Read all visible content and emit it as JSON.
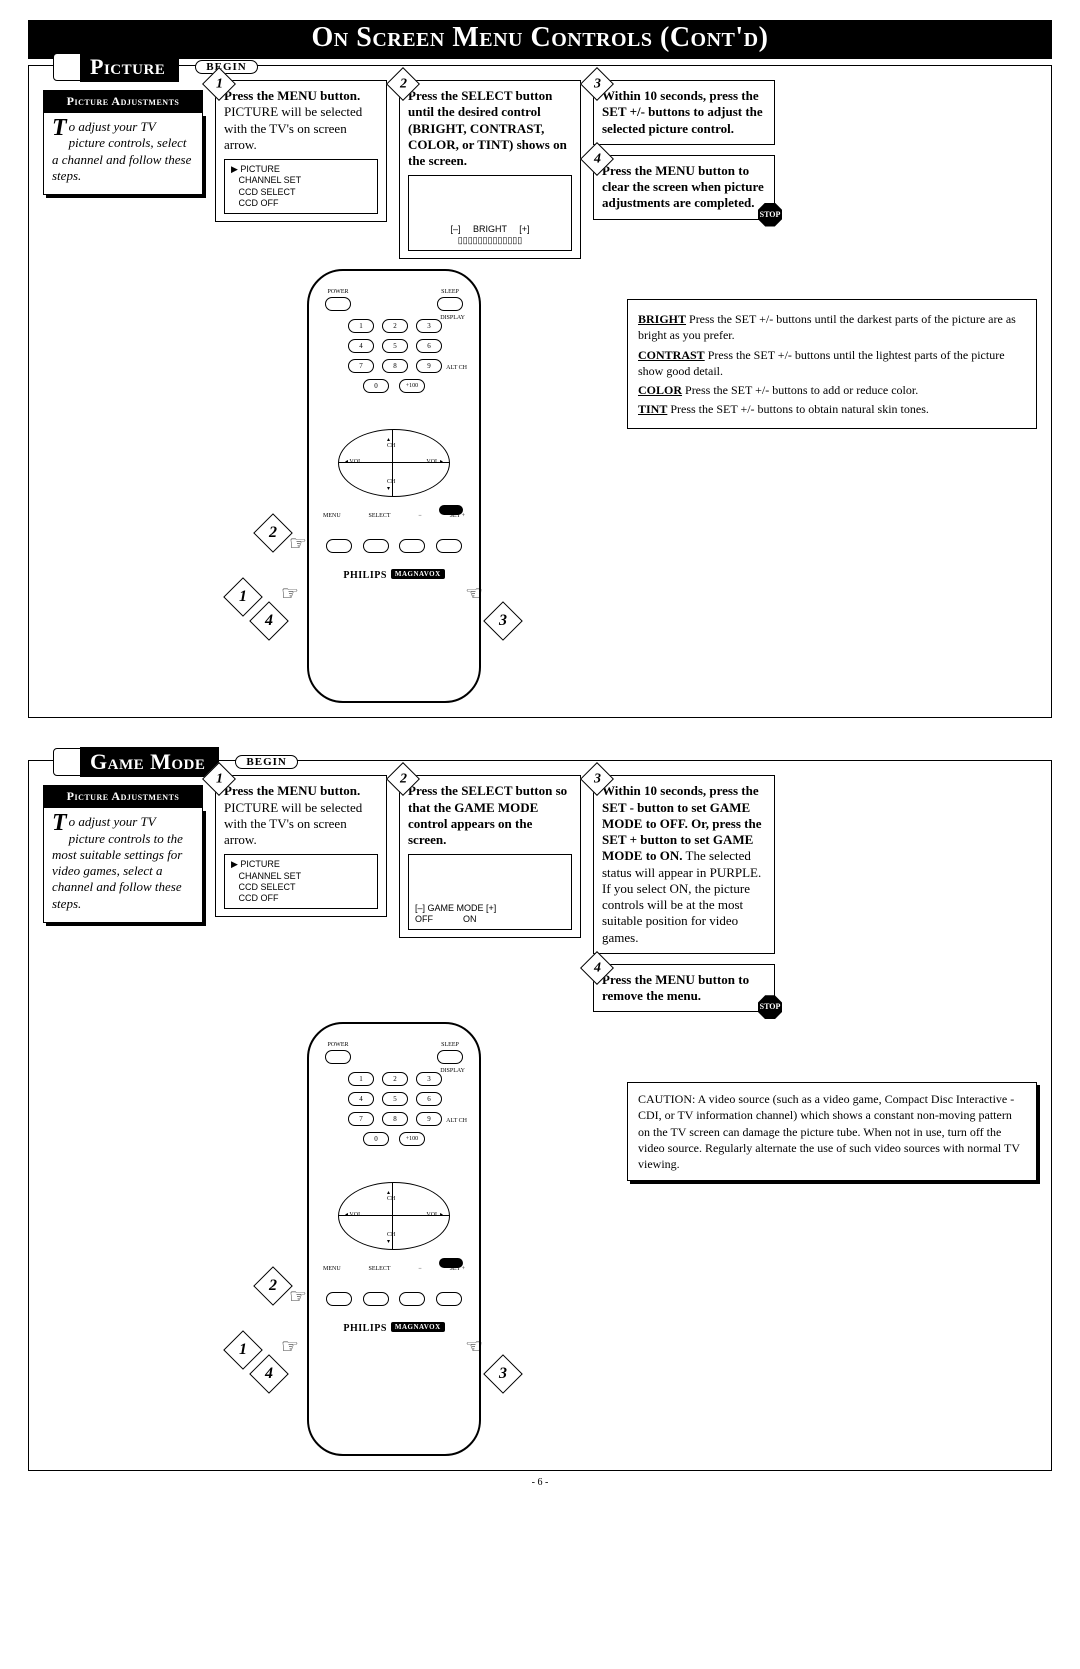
{
  "header": {
    "title": "On Screen Menu Controls (Cont'd)"
  },
  "begin_label": "BEGIN",
  "stop_label": "STOP",
  "remote": {
    "power": "POWER",
    "sleep": "SLEEP",
    "display": "DISPLAY",
    "alt_ch": "ALT CH",
    "menu": "MENU",
    "select": "SELECT",
    "minus": "−",
    "plus": "SET +",
    "ch_up": "CH",
    "ch_dn": "CH",
    "vol_l": "◂ VOL",
    "vol_r": "VOL ▸",
    "brand1": "PHILIPS",
    "brand2": "MAGNAVOX",
    "screen_menu": "▶ PICTURE\n   CHANNEL SET\n   CCD SELECT\n   CCD OFF"
  },
  "picture": {
    "title": "Picture",
    "adj_title": "Picture Adjustments",
    "adj_text": "o adjust your TV picture controls, select a channel and follow these steps.",
    "step1": "Press the MENU button. PICTURE will be selected with the TV's on screen arrow.",
    "step2": "Press the SELECT button until the desired control (BRIGHT, CONTRAST, COLOR, or TINT) shows on the screen.",
    "step2_screen": "[–]     BRIGHT     [+]\n▯▯▯▯▯▯▯▯▯▯▯▯▯",
    "step3": "Within 10 seconds, press the SET +/- buttons to adjust the selected picture control.",
    "step4": "Press the MENU button to clear the screen when picture adjustments are completed.",
    "defs": {
      "bright": "BRIGHT Press the SET +/- buttons until the darkest parts of the picture are as bright as you prefer.",
      "contrast": "CONTRAST Press the SET +/- buttons until the lightest parts of the picture show good detail.",
      "color": "COLOR Press the SET +/- buttons to add or reduce color.",
      "tint": "TINT Press the SET +/- buttons to obtain natural skin tones."
    }
  },
  "game": {
    "title": "Game Mode",
    "adj_title": "Picture Adjustments",
    "adj_text": "o adjust your TV picture controls to the most suitable settings for video games, select a channel and follow these steps.",
    "step1": "Press the MENU button. PICTURE will be selected with the TV's on screen arrow.",
    "step2": "Press the SELECT button so that the GAME MODE control appears on the screen.",
    "step2_screen": "[–] GAME MODE [+]\nOFF            ON",
    "step3a": "Within 10 seconds, press the SET - button to set GAME MODE to OFF. Or, press the SET + button to set GAME MODE to ON.",
    "step3b": " The selected status will appear in PURPLE. If you select ON, the picture controls will be at the most suitable position for video games.",
    "step4": "Press the MENU button to remove the menu.",
    "caution": "CAUTION: A video source (such as a video game, Compact Disc Interactive - CDI, or TV information channel) which shows a constant non-moving pattern on the TV screen can damage the picture tube. When not in use, turn off the video source. Regularly alternate the use of such video sources with normal TV viewing."
  },
  "footer": "- 6 -"
}
